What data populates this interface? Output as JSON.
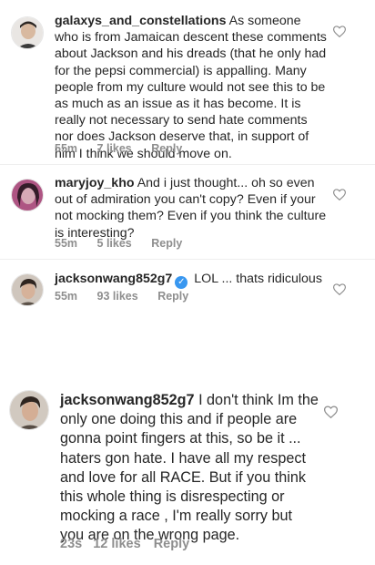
{
  "comments": [
    {
      "username": "galaxys_and_constellations",
      "text": "As someone who is from Jamaican descent these comments about Jackson and his dreads (that he only had for the pepsi commercial) is appalling. Many people from my culture would not see this to be as much as an issue as it has become. It is really not necessary to send hate comments nor does Jackson deserve that, in support of him I think we should move on.",
      "time": "55m",
      "likes": "7 likes",
      "reply": "Reply",
      "verified": false
    },
    {
      "username": "maryjoy_kho",
      "text": "And i just thought... oh so even out of admiration you can't copy? Even if  your not mocking them? Even if you think the culture is interesting?",
      "time": "55m",
      "likes": "5 likes",
      "reply": "Reply",
      "verified": false
    },
    {
      "username": "jacksonwang852g7",
      "text": "LOL ... thats ridiculous",
      "time": "55m",
      "likes": "93 likes",
      "reply": "Reply",
      "verified": true
    },
    {
      "username": "jacksonwang852g7",
      "text": "I don't think Im the only one doing this and if people are gonna point fingers at this, so be it ... haters gon hate. I have all my respect and love  for all RACE. But if you think this whole thing is disrespecting or mocking a race , I'm really sorry but you are on the wrong page.",
      "time": "23s",
      "likes": "12 likes",
      "reply": "Reply",
      "verified": false
    }
  ],
  "icons": {
    "like": "heart-outline-icon",
    "verified": "verified-badge-icon"
  },
  "colors": {
    "text": "#262626",
    "meta": "#8e8e8e",
    "verified": "#3897f0",
    "divider": "#efefef"
  }
}
